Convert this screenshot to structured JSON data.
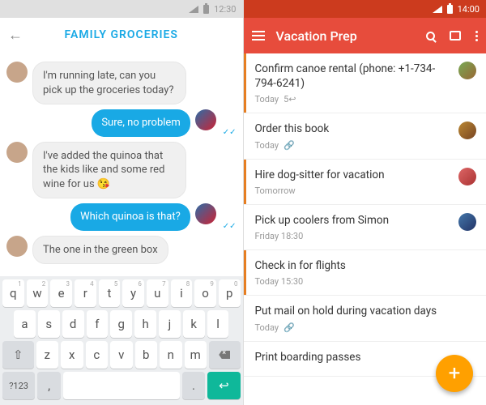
{
  "left": {
    "status": {
      "time": "12:30"
    },
    "header": {
      "title": "FAMILY GROCERIES"
    },
    "messages": [
      {
        "side": "left",
        "text": "I'm running late, can you pick up the groceries today?"
      },
      {
        "side": "right",
        "text": "Sure, no problem"
      },
      {
        "side": "left",
        "text": "I've added the quinoa that the kids like and some red wine for us 😘"
      },
      {
        "side": "right",
        "text": "Which quinoa is that?"
      },
      {
        "side": "left",
        "text": "The one in the green box"
      }
    ],
    "keyboard": {
      "row1": [
        "q",
        "w",
        "e",
        "r",
        "t",
        "y",
        "u",
        "i",
        "o",
        "p"
      ],
      "row1_nums": [
        "1",
        "2",
        "3",
        "4",
        "5",
        "6",
        "7",
        "8",
        "9",
        "0"
      ],
      "row2": [
        "a",
        "s",
        "d",
        "f",
        "g",
        "h",
        "j",
        "k",
        "l"
      ],
      "row3": [
        "z",
        "x",
        "c",
        "v",
        "b",
        "n",
        "m"
      ],
      "shift": "⇧",
      "sym": "?123",
      "comma": ",",
      "period": ".",
      "enter": "↩"
    }
  },
  "right": {
    "status": {
      "time": "14:00"
    },
    "header": {
      "title": "Vacation Prep"
    },
    "tasks": [
      {
        "title": "Confirm canoe rental (phone: +1-734-794-6241)",
        "meta": "Today",
        "extra": "5↩",
        "priority": true,
        "av": "c1"
      },
      {
        "title": "Order this book",
        "meta": "Today",
        "clip": true,
        "priority": false,
        "av": "c2"
      },
      {
        "title": "Hire dog-sitter for vacation",
        "meta": "Tomorrow",
        "priority": true,
        "av": "c3"
      },
      {
        "title": "Pick up coolers from Simon",
        "meta": "Friday 18:30",
        "priority": false,
        "av": "c4"
      },
      {
        "title": "Check in for flights",
        "meta": "Today 15:30",
        "priority": true
      },
      {
        "title": "Put mail on hold during vacation days",
        "meta": "Today",
        "clip": true,
        "priority": false
      },
      {
        "title": "Print boarding passes",
        "meta": "",
        "priority": false
      }
    ],
    "fab": "+"
  }
}
